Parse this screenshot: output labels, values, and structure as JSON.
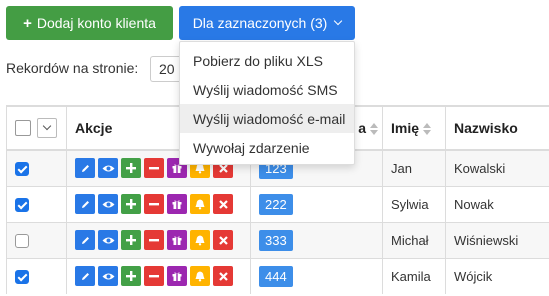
{
  "toolbar": {
    "add_label": "Dodaj konto klienta",
    "selected_label": "Dla zaznaczonych (3)"
  },
  "records": {
    "label": "Rekordów na stronie:",
    "value": "20"
  },
  "dropdown": {
    "items": [
      {
        "label": "Pobierz do pliku XLS"
      },
      {
        "label": "Wyślij wiadomość SMS"
      },
      {
        "label": "Wyślij wiadomość e-mail",
        "highlighted": true
      },
      {
        "label": "Wywołaj zdarzenie"
      }
    ]
  },
  "table": {
    "headers": {
      "actions": "Akcje",
      "id_tail": "a",
      "first_name": "Imię",
      "last_name": "Nazwisko"
    },
    "rows": [
      {
        "checked": true,
        "id": "123",
        "first_name": "Jan",
        "last_name": "Kowalski"
      },
      {
        "checked": true,
        "id": "222",
        "first_name": "Sylwia",
        "last_name": "Nowak"
      },
      {
        "checked": false,
        "id": "333",
        "first_name": "Michał",
        "last_name": "Wiśniewski"
      },
      {
        "checked": true,
        "id": "444",
        "first_name": "Kamila",
        "last_name": "Wójcik"
      }
    ]
  },
  "colors": {
    "green_button": "#449d44",
    "blue_button": "#2979e6",
    "badge": "#3d8ee9",
    "action_blue": "#2979e6",
    "action_green": "#43a047",
    "action_red": "#e53935",
    "action_purple": "#9c27b0",
    "action_yellow": "#ffb300"
  },
  "action_icons": [
    "pencil-icon",
    "eye-icon",
    "plus-icon",
    "minus-icon",
    "gift-icon",
    "bell-icon",
    "close-icon"
  ]
}
